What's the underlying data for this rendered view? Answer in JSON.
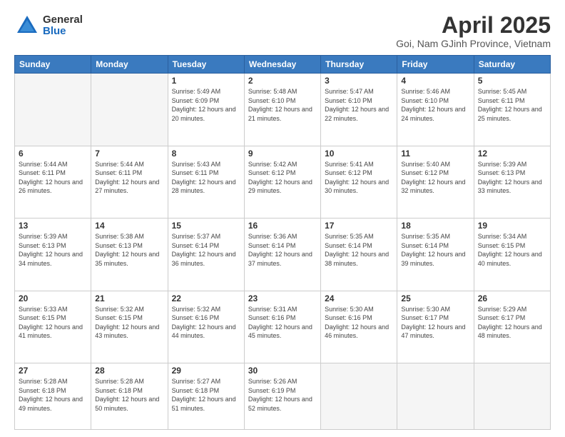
{
  "logo": {
    "general": "General",
    "blue": "Blue"
  },
  "title": "April 2025",
  "subtitle": "Goi, Nam GJinh Province, Vietnam",
  "days_of_week": [
    "Sunday",
    "Monday",
    "Tuesday",
    "Wednesday",
    "Thursday",
    "Friday",
    "Saturday"
  ],
  "weeks": [
    [
      {
        "day": "",
        "info": ""
      },
      {
        "day": "",
        "info": ""
      },
      {
        "day": "1",
        "info": "Sunrise: 5:49 AM\nSunset: 6:09 PM\nDaylight: 12 hours and 20 minutes."
      },
      {
        "day": "2",
        "info": "Sunrise: 5:48 AM\nSunset: 6:10 PM\nDaylight: 12 hours and 21 minutes."
      },
      {
        "day": "3",
        "info": "Sunrise: 5:47 AM\nSunset: 6:10 PM\nDaylight: 12 hours and 22 minutes."
      },
      {
        "day": "4",
        "info": "Sunrise: 5:46 AM\nSunset: 6:10 PM\nDaylight: 12 hours and 24 minutes."
      },
      {
        "day": "5",
        "info": "Sunrise: 5:45 AM\nSunset: 6:11 PM\nDaylight: 12 hours and 25 minutes."
      }
    ],
    [
      {
        "day": "6",
        "info": "Sunrise: 5:44 AM\nSunset: 6:11 PM\nDaylight: 12 hours and 26 minutes."
      },
      {
        "day": "7",
        "info": "Sunrise: 5:44 AM\nSunset: 6:11 PM\nDaylight: 12 hours and 27 minutes."
      },
      {
        "day": "8",
        "info": "Sunrise: 5:43 AM\nSunset: 6:11 PM\nDaylight: 12 hours and 28 minutes."
      },
      {
        "day": "9",
        "info": "Sunrise: 5:42 AM\nSunset: 6:12 PM\nDaylight: 12 hours and 29 minutes."
      },
      {
        "day": "10",
        "info": "Sunrise: 5:41 AM\nSunset: 6:12 PM\nDaylight: 12 hours and 30 minutes."
      },
      {
        "day": "11",
        "info": "Sunrise: 5:40 AM\nSunset: 6:12 PM\nDaylight: 12 hours and 32 minutes."
      },
      {
        "day": "12",
        "info": "Sunrise: 5:39 AM\nSunset: 6:13 PM\nDaylight: 12 hours and 33 minutes."
      }
    ],
    [
      {
        "day": "13",
        "info": "Sunrise: 5:39 AM\nSunset: 6:13 PM\nDaylight: 12 hours and 34 minutes."
      },
      {
        "day": "14",
        "info": "Sunrise: 5:38 AM\nSunset: 6:13 PM\nDaylight: 12 hours and 35 minutes."
      },
      {
        "day": "15",
        "info": "Sunrise: 5:37 AM\nSunset: 6:14 PM\nDaylight: 12 hours and 36 minutes."
      },
      {
        "day": "16",
        "info": "Sunrise: 5:36 AM\nSunset: 6:14 PM\nDaylight: 12 hours and 37 minutes."
      },
      {
        "day": "17",
        "info": "Sunrise: 5:35 AM\nSunset: 6:14 PM\nDaylight: 12 hours and 38 minutes."
      },
      {
        "day": "18",
        "info": "Sunrise: 5:35 AM\nSunset: 6:14 PM\nDaylight: 12 hours and 39 minutes."
      },
      {
        "day": "19",
        "info": "Sunrise: 5:34 AM\nSunset: 6:15 PM\nDaylight: 12 hours and 40 minutes."
      }
    ],
    [
      {
        "day": "20",
        "info": "Sunrise: 5:33 AM\nSunset: 6:15 PM\nDaylight: 12 hours and 41 minutes."
      },
      {
        "day": "21",
        "info": "Sunrise: 5:32 AM\nSunset: 6:15 PM\nDaylight: 12 hours and 43 minutes."
      },
      {
        "day": "22",
        "info": "Sunrise: 5:32 AM\nSunset: 6:16 PM\nDaylight: 12 hours and 44 minutes."
      },
      {
        "day": "23",
        "info": "Sunrise: 5:31 AM\nSunset: 6:16 PM\nDaylight: 12 hours and 45 minutes."
      },
      {
        "day": "24",
        "info": "Sunrise: 5:30 AM\nSunset: 6:16 PM\nDaylight: 12 hours and 46 minutes."
      },
      {
        "day": "25",
        "info": "Sunrise: 5:30 AM\nSunset: 6:17 PM\nDaylight: 12 hours and 47 minutes."
      },
      {
        "day": "26",
        "info": "Sunrise: 5:29 AM\nSunset: 6:17 PM\nDaylight: 12 hours and 48 minutes."
      }
    ],
    [
      {
        "day": "27",
        "info": "Sunrise: 5:28 AM\nSunset: 6:18 PM\nDaylight: 12 hours and 49 minutes."
      },
      {
        "day": "28",
        "info": "Sunrise: 5:28 AM\nSunset: 6:18 PM\nDaylight: 12 hours and 50 minutes."
      },
      {
        "day": "29",
        "info": "Sunrise: 5:27 AM\nSunset: 6:18 PM\nDaylight: 12 hours and 51 minutes."
      },
      {
        "day": "30",
        "info": "Sunrise: 5:26 AM\nSunset: 6:19 PM\nDaylight: 12 hours and 52 minutes."
      },
      {
        "day": "",
        "info": ""
      },
      {
        "day": "",
        "info": ""
      },
      {
        "day": "",
        "info": ""
      }
    ]
  ]
}
